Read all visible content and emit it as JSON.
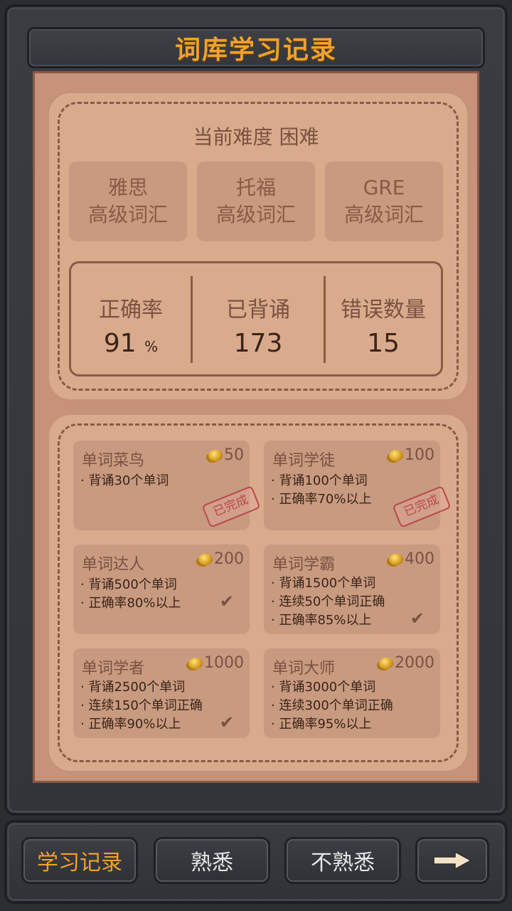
{
  "title": "词库学习记录",
  "difficulty_text": "当前难度 困难",
  "banks": [
    {
      "line1": "雅思",
      "line2": "高级词汇"
    },
    {
      "line1": "托福",
      "line2": "高级词汇"
    },
    {
      "line1": "GRE",
      "line2": "高级词汇"
    }
  ],
  "stats": {
    "accuracy_label": "正确率",
    "accuracy_value": "91",
    "accuracy_unit": "%",
    "memorized_label": "已背诵",
    "memorized_value": "173",
    "errors_label": "错误数量",
    "errors_value": "15"
  },
  "achievements": [
    {
      "name": "单词菜鸟",
      "reward": "50",
      "reqs": [
        "· 背诵30个单词"
      ],
      "stamp": "已完成"
    },
    {
      "name": "单词学徒",
      "reward": "100",
      "reqs": [
        "· 背诵100个单词",
        "· 正确率70%以上"
      ],
      "stamp": "已完成"
    },
    {
      "name": "单词达人",
      "reward": "200",
      "reqs": [
        "· 背诵500个单词",
        "· 正确率80%以上"
      ],
      "check": "✔"
    },
    {
      "name": "单词学霸",
      "reward": "400",
      "reqs": [
        "· 背诵1500个单词",
        "· 连续50个单词正确",
        "· 正确率85%以上"
      ],
      "check": "✔"
    },
    {
      "name": "单词学者",
      "reward": "1000",
      "reqs": [
        "· 背诵2500个单词",
        "· 连续150个单词正确",
        "· 正确率90%以上"
      ],
      "check": "✔"
    },
    {
      "name": "单词大师",
      "reward": "2000",
      "reqs": [
        "· 背诵3000个单词",
        "· 连续300个单词正确",
        "· 正确率95%以上"
      ]
    }
  ],
  "buttons": {
    "records": "学习记录",
    "familiar": "熟悉",
    "unfamiliar": "不熟悉",
    "next_icon": "arrow-right-icon"
  }
}
